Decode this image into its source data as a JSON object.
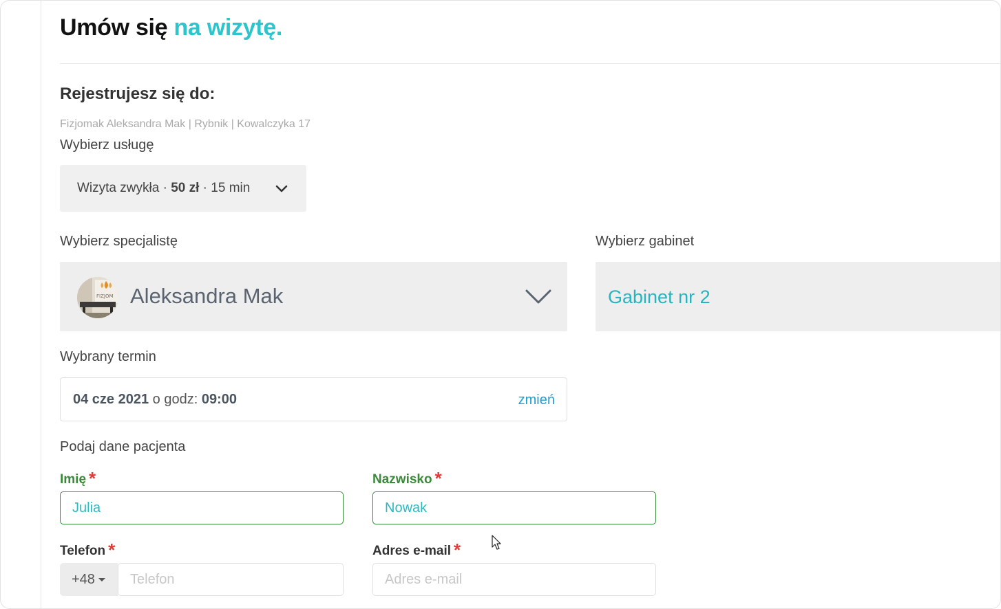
{
  "header": {
    "title_main": "Umów się",
    "title_accent": "na wizytę."
  },
  "registration": {
    "heading": "Rejestrujesz się do:",
    "clinic_info": "Fizjomak Aleksandra Mak | Rybnik | Kowalczyka 17"
  },
  "service": {
    "label": "Wybierz usługę",
    "name": "Wizyta zwykła ·",
    "price": "50 zł",
    "duration": "· 15 min",
    "icon": "chevron-down-icon"
  },
  "specialist": {
    "label": "Wybierz specjalistę",
    "name": "Aleksandra Mak",
    "avatar_text": "FIZJOM",
    "icon": "chevron-down-icon"
  },
  "office": {
    "label": "Wybierz gabinet",
    "name": "Gabinet nr 2"
  },
  "appointment": {
    "label": "Wybrany termin",
    "date": "04 cze 2021",
    "connector": "o godz:",
    "time": "09:00",
    "change_link": "zmień"
  },
  "patient": {
    "label": "Podaj dane pacjenta",
    "required_mark": "*",
    "first_name": {
      "label": "Imię",
      "value": "Julia"
    },
    "last_name": {
      "label": "Nazwisko",
      "value": "Nowak"
    },
    "phone": {
      "label": "Telefon",
      "prefix": "+48",
      "value": "",
      "placeholder": "Telefon"
    },
    "email": {
      "label": "Adres e-mail",
      "value": "",
      "placeholder": "Adres e-mail"
    }
  },
  "colors": {
    "accent": "#2ec4cc",
    "valid_border": "#3a8a3a",
    "link": "#1e9fd2",
    "required": "#e53935"
  }
}
